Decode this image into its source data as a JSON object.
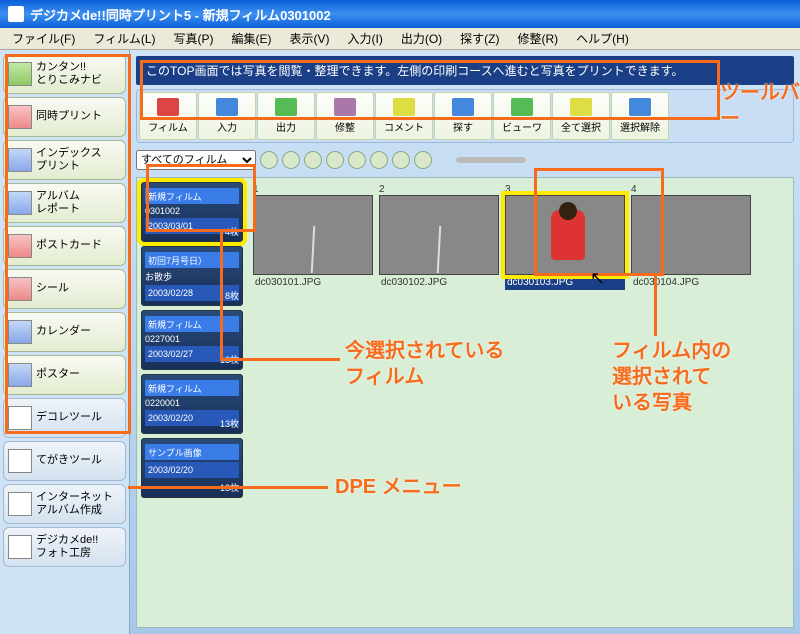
{
  "window": {
    "title": "デジカメde!!同時プリント5 - 新規フィルム0301002"
  },
  "menu": [
    "ファイル(F)",
    "フィルム(L)",
    "写真(P)",
    "編集(E)",
    "表示(V)",
    "入力(I)",
    "出力(O)",
    "探す(Z)",
    "修整(R)",
    "ヘルプ(H)"
  ],
  "sidebar": [
    {
      "label": "カンタン!!\nとりこみナビ",
      "ic": "green"
    },
    {
      "label": "同時プリント",
      "ic": "red"
    },
    {
      "label": "インデックス\nプリント",
      "ic": "blue"
    },
    {
      "label": "アルバム\nレポート",
      "ic": "blue"
    },
    {
      "label": "ポストカード",
      "ic": "red"
    },
    {
      "label": "シール",
      "ic": "red"
    },
    {
      "label": "カレンダー",
      "ic": "blue"
    },
    {
      "label": "ポスター",
      "ic": "blue"
    },
    {
      "label": "デコレツール",
      "ic": "",
      "alt": true
    },
    {
      "label": "てがきツール",
      "ic": "",
      "alt": true
    },
    {
      "label": "インターネット\nアルバム作成",
      "ic": "",
      "alt": true
    },
    {
      "label": "デジカメde!!\nフォト工房",
      "ic": "",
      "alt": true
    }
  ],
  "infobar": "このTOP画面では写真を閲覧・整理できます。左側の印刷コースへ進むと写真をプリントできます。",
  "toolbar": [
    {
      "label": "フィルム",
      "cls": ""
    },
    {
      "label": "入力",
      "cls": "b"
    },
    {
      "label": "出力",
      "cls": "g"
    },
    {
      "label": "修整",
      "cls": "p"
    },
    {
      "label": "コメント",
      "cls": "y"
    },
    {
      "label": "探す",
      "cls": "b"
    },
    {
      "label": "ビューワ",
      "cls": "g"
    },
    {
      "label": "全て選択",
      "cls": "y"
    },
    {
      "label": "選択解除",
      "cls": "b"
    }
  ],
  "filter": {
    "label": "すべてのフィルム"
  },
  "films": [
    {
      "name": "新規フィルム",
      "sub": "0301002",
      "date": "2003/03/01",
      "count": "4枚",
      "sel": true
    },
    {
      "name": "初回7月号日）",
      "sub": "お散歩",
      "date": "2003/02/28",
      "count": "8枚"
    },
    {
      "name": "新規フィルム",
      "sub": "0227001",
      "date": "2003/02/27",
      "count": "13枚"
    },
    {
      "name": "新規フィルム",
      "sub": "0220001",
      "date": "2003/02/20",
      "count": "13枚"
    },
    {
      "name": "サンプル画像",
      "sub": "",
      "date": "2003/02/20",
      "count": "13枚"
    }
  ],
  "thumbs": [
    {
      "num": "1",
      "file": "dc030101.JPG",
      "cls": "road"
    },
    {
      "num": "2",
      "file": "dc030102.JPG",
      "cls": "road"
    },
    {
      "num": "3",
      "file": "dc030103.JPG",
      "cls": "girl",
      "sel": true
    },
    {
      "num": "4",
      "file": "dc030104.JPG",
      "cls": "park"
    }
  ],
  "ann": {
    "toolbar": "ツールバー",
    "film": "今選択されている\nフィルム",
    "photo": "フィルム内の\n選択されて\nいる写真",
    "dpe": "DPE メニュー"
  }
}
